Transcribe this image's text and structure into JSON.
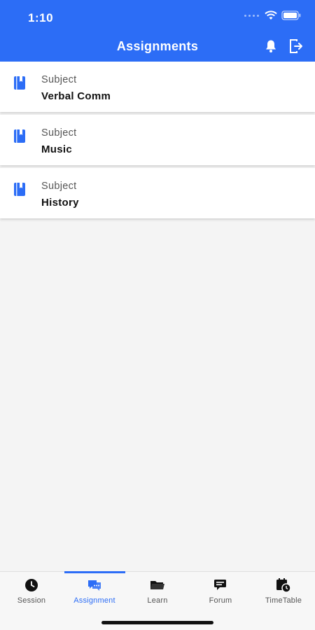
{
  "status_bar": {
    "time": "1:10"
  },
  "header": {
    "title": "Assignments",
    "bell_icon": "bell-icon",
    "logout_icon": "logout-icon"
  },
  "assignments": [
    {
      "label": "Subject",
      "value": "Verbal Comm",
      "icon": "book-icon"
    },
    {
      "label": "Subject",
      "value": "Music",
      "icon": "book-icon"
    },
    {
      "label": "Subject",
      "value": "History",
      "icon": "book-icon"
    }
  ],
  "bottom_nav": {
    "active": "Assignment",
    "items": [
      {
        "label": "Session",
        "icon": "clock-icon"
      },
      {
        "label": "Assignment",
        "icon": "chat-bubble-icon"
      },
      {
        "label": "Learn",
        "icon": "folder-icon"
      },
      {
        "label": "Forum",
        "icon": "forum-icon"
      },
      {
        "label": "TimeTable",
        "icon": "calendar-clock-icon"
      }
    ]
  },
  "colors": {
    "primary": "#2c6df6",
    "background": "#f4f4f4",
    "card": "#ffffff"
  }
}
